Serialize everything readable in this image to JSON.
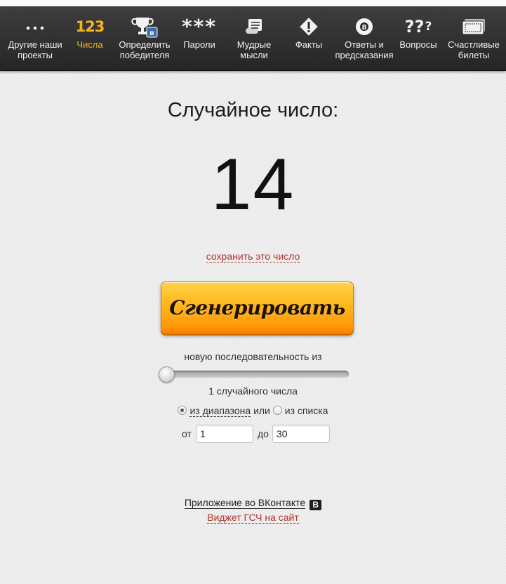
{
  "nav": {
    "items": [
      {
        "name": "other-projects",
        "label": "Другие наши проекты",
        "active": false,
        "icon": "ellipsis-icon"
      },
      {
        "name": "numbers",
        "label": "Числа",
        "active": true,
        "icon": "numbers-123-icon"
      },
      {
        "name": "winner",
        "label": "Определить победителя",
        "active": false,
        "icon": "trophy-vk-icon"
      },
      {
        "name": "passwords",
        "label": "Пароли",
        "active": false,
        "icon": "asterisks-icon"
      },
      {
        "name": "wise-thoughts",
        "label": "Мудрые мысли",
        "active": false,
        "icon": "scroll-icon"
      },
      {
        "name": "facts",
        "label": "Факты",
        "active": false,
        "icon": "warning-diamond-icon"
      },
      {
        "name": "answers",
        "label": "Ответы и предсказания",
        "active": false,
        "icon": "magic-8-ball-icon"
      },
      {
        "name": "questions",
        "label": "Вопросы",
        "active": false,
        "icon": "question-marks-icon"
      },
      {
        "name": "lucky-tickets",
        "label": "Счастливые билеты",
        "active": false,
        "icon": "ticket-icon"
      }
    ],
    "icon_text": {
      "numbers": "123",
      "passwords": "***",
      "questions": "??",
      "eight": "8",
      "vk": "в"
    },
    "active_color": "#f5b521"
  },
  "main": {
    "title": "Случайное число:",
    "result": "14",
    "save_link": "сохранить это число",
    "generate_button": "Сгенерировать",
    "sequence_label": "новую последовательность из",
    "count_label": "1 случайного числа",
    "slider_value": 1,
    "radio": {
      "from_range": "из диапазона",
      "or": "или",
      "from_list": "из списка",
      "selected": "from_range"
    },
    "range": {
      "from_label": "от",
      "from_value": "1",
      "to_label": "до",
      "to_value": "30"
    },
    "vk_app_link": "Приложение во ВКонтакте",
    "vk_badge": "B",
    "widget_link": "Виджет ГСЧ на сайт"
  },
  "colors": {
    "button": "#ffb61a",
    "link_red": "#b0342c",
    "navbar": "#2b2b2b"
  }
}
